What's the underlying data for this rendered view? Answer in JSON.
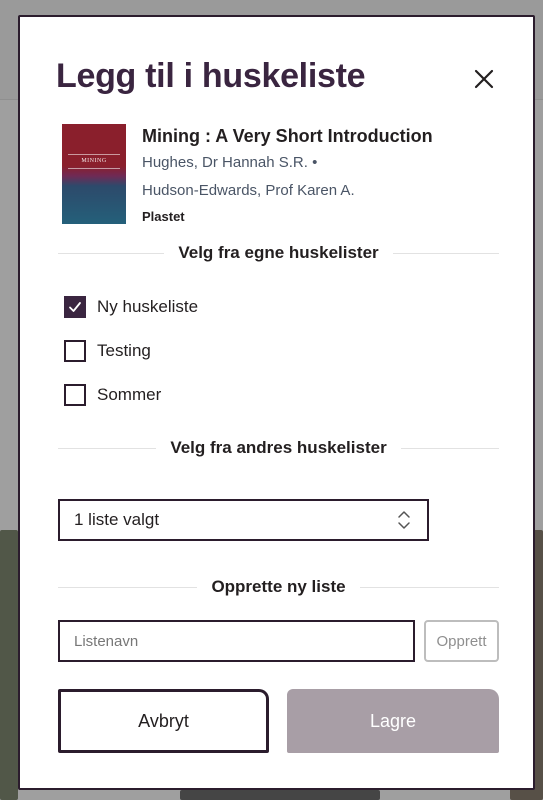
{
  "modal": {
    "title": "Legg til i huskeliste",
    "close_icon": "close-icon"
  },
  "book": {
    "cover_title": "MINING",
    "title": "Mining : A Very Short Introduction",
    "author_line1": "Hughes, Dr Hannah S.R. •",
    "author_line2": "Hudson-Edwards, Prof Karen A.",
    "format": "Plastet",
    "cover_colors": [
      "#8a1f2c",
      "#24607a"
    ]
  },
  "own_lists": {
    "heading": "Velg fra egne huskelister",
    "items": [
      {
        "label": "Ny huskeliste",
        "checked": true
      },
      {
        "label": "Testing",
        "checked": false
      },
      {
        "label": "Sommer",
        "checked": false
      }
    ]
  },
  "others_lists": {
    "heading": "Velg fra andres huskelister",
    "select_value": "1 liste valgt",
    "select_icon": "chevron-up-down-icon"
  },
  "new_list": {
    "heading": "Opprette ny liste",
    "input_placeholder": "Listenavn",
    "input_value": "",
    "create_label": "Opprett"
  },
  "footer": {
    "cancel_label": "Avbryt",
    "save_label": "Lagre"
  },
  "colors": {
    "accent": "#3a2540",
    "border": "#2b1c2d",
    "disabled_button": "#a89ea6"
  }
}
